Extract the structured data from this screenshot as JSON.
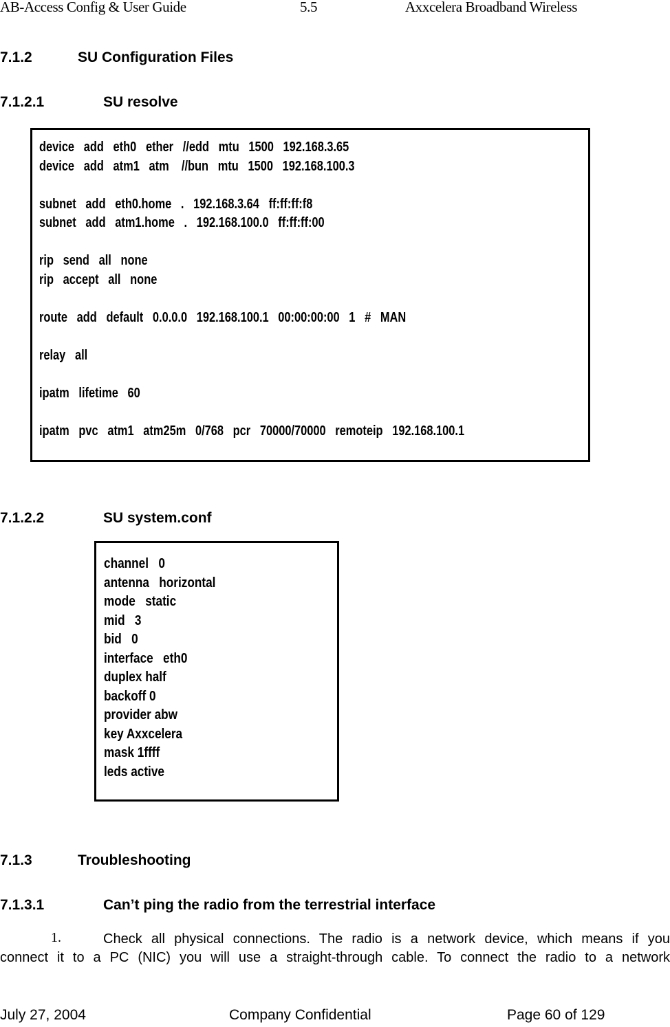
{
  "header": {
    "left": "AB-Access Config & User Guide",
    "middle": "5.5",
    "right": "Axxcelera Broadband Wireless"
  },
  "sections": {
    "s712": {
      "number": "7.1.2",
      "title": "SU Configuration Files"
    },
    "s7121": {
      "number": "7.1.2.1",
      "title": "SU resolve"
    },
    "s7122": {
      "number": "7.1.2.2",
      "title": "SU system.conf"
    },
    "s713": {
      "number": "7.1.3",
      "title": "Troubleshooting"
    },
    "s7131": {
      "number": "7.1.3.1",
      "title": "Can’t ping the radio from the terrestrial interface"
    }
  },
  "resolve_file": {
    "lines": [
      "device   add   eth0   ether   //edd   mtu   1500   192.168.3.65",
      "device   add   atm1   atm    //bun   mtu   1500   192.168.100.3",
      "",
      "subnet   add   eth0.home   .   192.168.3.64   ff:ff:ff:f8",
      "subnet   add   atm1.home   .   192.168.100.0   ff:ff:ff:00",
      "",
      "rip   send   all   none",
      "rip   accept   all   none",
      "",
      "route   add   default   0.0.0.0   192.168.100.1   00:00:00:00   1   #   MAN",
      "",
      "relay   all",
      "",
      "ipatm   lifetime   60",
      "",
      "ipatm   pvc   atm1   atm25m   0/768   pcr   70000/70000   remoteip   192.168.100.1"
    ]
  },
  "system_conf_file": {
    "lines": [
      "channel   0",
      "antenna   horizontal",
      "mode   static",
      "mid   3",
      "bid   0",
      "interface   eth0",
      "duplex half",
      "backoff 0",
      "provider abw",
      "key Axxcelera",
      "mask 1ffff",
      "leds active"
    ]
  },
  "troubleshooting": {
    "item_number": "1.",
    "line1": "Check all physical connections.  The radio is a network device, which means if you",
    "line2": "connect it to a PC (NIC) you will use a straight-through cable.  To connect the radio to a network"
  },
  "footer": {
    "date": "July 27, 2004",
    "confidential": "Company Confidential",
    "page": "Page 60 of 129"
  }
}
